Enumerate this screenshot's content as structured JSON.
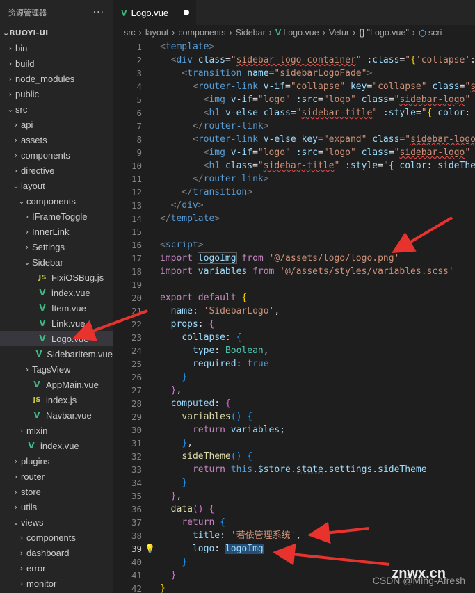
{
  "sidebar": {
    "title": "资源管理器",
    "more": "···",
    "project": "RUOYI-UI",
    "items": [
      {
        "label": "bin",
        "depth": 1,
        "kind": "folder",
        "open": false
      },
      {
        "label": "build",
        "depth": 1,
        "kind": "folder",
        "open": false
      },
      {
        "label": "node_modules",
        "depth": 1,
        "kind": "folder",
        "open": false
      },
      {
        "label": "public",
        "depth": 1,
        "kind": "folder",
        "open": false
      },
      {
        "label": "src",
        "depth": 1,
        "kind": "folder",
        "open": true
      },
      {
        "label": "api",
        "depth": 2,
        "kind": "folder",
        "open": false
      },
      {
        "label": "assets",
        "depth": 2,
        "kind": "folder",
        "open": false
      },
      {
        "label": "components",
        "depth": 2,
        "kind": "folder",
        "open": false
      },
      {
        "label": "directive",
        "depth": 2,
        "kind": "folder",
        "open": false
      },
      {
        "label": "layout",
        "depth": 2,
        "kind": "folder",
        "open": true
      },
      {
        "label": "components",
        "depth": 3,
        "kind": "folder",
        "open": true
      },
      {
        "label": "IFrameToggle",
        "depth": 4,
        "kind": "folder",
        "open": false
      },
      {
        "label": "InnerLink",
        "depth": 4,
        "kind": "folder",
        "open": false
      },
      {
        "label": "Settings",
        "depth": 4,
        "kind": "folder",
        "open": false
      },
      {
        "label": "Sidebar",
        "depth": 4,
        "kind": "folder",
        "open": true
      },
      {
        "label": "FixiOSBug.js",
        "depth": 5,
        "kind": "js"
      },
      {
        "label": "index.vue",
        "depth": 5,
        "kind": "vue"
      },
      {
        "label": "Item.vue",
        "depth": 5,
        "kind": "vue"
      },
      {
        "label": "Link.vue",
        "depth": 5,
        "kind": "vue"
      },
      {
        "label": "Logo.vue",
        "depth": 5,
        "kind": "vue",
        "selected": true
      },
      {
        "label": "SidebarItem.vue",
        "depth": 5,
        "kind": "vue"
      },
      {
        "label": "TagsView",
        "depth": 4,
        "kind": "folder",
        "open": false
      },
      {
        "label": "AppMain.vue",
        "depth": 4,
        "kind": "vue"
      },
      {
        "label": "index.js",
        "depth": 4,
        "kind": "js"
      },
      {
        "label": "Navbar.vue",
        "depth": 4,
        "kind": "vue"
      },
      {
        "label": "mixin",
        "depth": 3,
        "kind": "folder",
        "open": false
      },
      {
        "label": "index.vue",
        "depth": 3,
        "kind": "vue"
      },
      {
        "label": "plugins",
        "depth": 2,
        "kind": "folder",
        "open": false
      },
      {
        "label": "router",
        "depth": 2,
        "kind": "folder",
        "open": false
      },
      {
        "label": "store",
        "depth": 2,
        "kind": "folder",
        "open": false
      },
      {
        "label": "utils",
        "depth": 2,
        "kind": "folder",
        "open": false
      },
      {
        "label": "views",
        "depth": 2,
        "kind": "folder",
        "open": true
      },
      {
        "label": "components",
        "depth": 3,
        "kind": "folder",
        "open": false
      },
      {
        "label": "dashboard",
        "depth": 3,
        "kind": "folder",
        "open": false
      },
      {
        "label": "error",
        "depth": 3,
        "kind": "folder",
        "open": false
      },
      {
        "label": "monitor",
        "depth": 3,
        "kind": "folder",
        "open": false
      }
    ]
  },
  "tab": {
    "label": "Logo.vue"
  },
  "breadcrumb": [
    "src",
    "layout",
    "components",
    "Sidebar",
    "Logo.vue",
    "Vetur",
    "\"Logo.vue\"",
    "scri"
  ],
  "active_line": 39,
  "watermark": {
    "site": "znwx.cn",
    "author": "CSDN @Ming-Afresh"
  },
  "colors": {
    "accent_vue": "#41b883",
    "js": "#cbcb41",
    "arrow": "#e8322e"
  }
}
